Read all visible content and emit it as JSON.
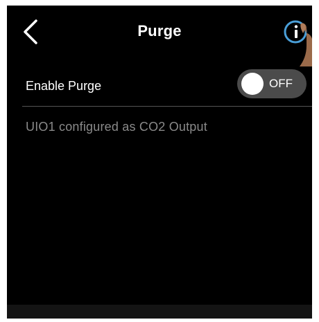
{
  "header": {
    "title": "Purge",
    "back_icon": "chevron-left-icon",
    "info_icon": "info-icon",
    "accent_color": "#4a9fd8"
  },
  "settings": {
    "enable_purge": {
      "label": "Enable Purge",
      "toggle_state": "OFF"
    }
  },
  "status": {
    "message": "UIO1 configured as CO2 Output"
  }
}
